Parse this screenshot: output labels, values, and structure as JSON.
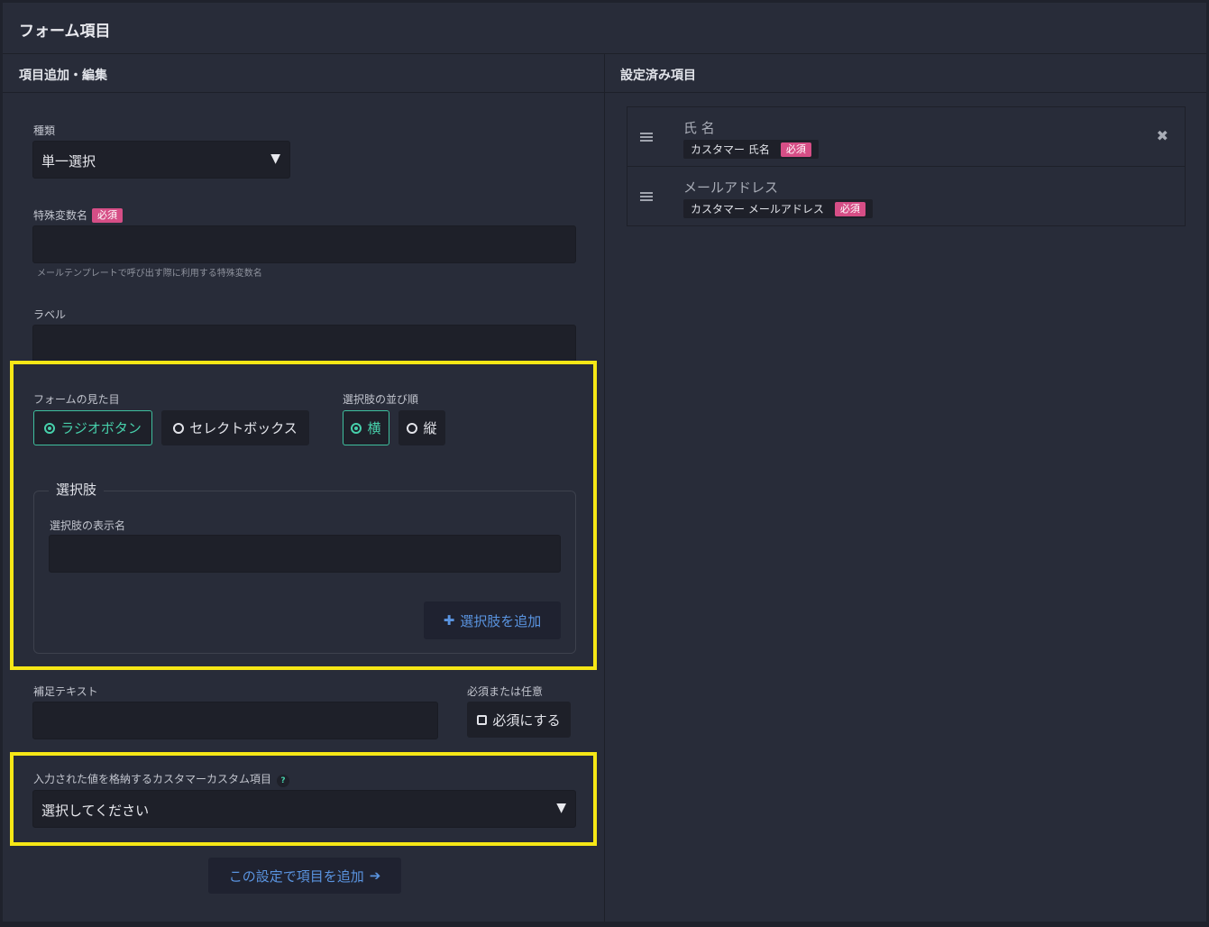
{
  "page": {
    "title": "フォーム項目"
  },
  "left": {
    "heading": "項目追加・編集",
    "type": {
      "label": "種類",
      "value": "単一選択"
    },
    "variable": {
      "label": "特殊変数名",
      "required": "必須",
      "hint": "メールテンプレートで呼び出す際に利用する特殊変数名",
      "value": ""
    },
    "label_field": {
      "label": "ラベル",
      "value": ""
    },
    "appearance": {
      "label": "フォームの見た目",
      "options": [
        "ラジオボタン",
        "セレクトボックス"
      ],
      "selected": 0
    },
    "order": {
      "label": "選択肢の並び順",
      "options": [
        "横",
        "縦"
      ],
      "selected": 0
    },
    "choices": {
      "legend": "選択肢",
      "display_label": "選択肢の表示名",
      "value": "",
      "add_button": "選択肢を追加"
    },
    "supplement": {
      "label": "補足テキスト",
      "value": ""
    },
    "required_opt": {
      "label": "必須または任意",
      "checkbox": "必須にする",
      "checked": false
    },
    "custom_field": {
      "label": "入力された値を格納するカスタマーカスタム項目",
      "help": "?",
      "value": "選択してください"
    },
    "submit": "この設定で項目を追加"
  },
  "right": {
    "heading": "設定済み項目",
    "items": [
      {
        "name": "氏 名",
        "tag": "カスタマー 氏名",
        "required": "必須",
        "removable": true
      },
      {
        "name": "メールアドレス",
        "tag": "カスタマー メールアドレス",
        "required": "必須",
        "removable": false
      }
    ]
  },
  "colors": {
    "accent": "#47d0ab",
    "link": "#5a94e0",
    "required": "#d64e86",
    "highlight": "#f6e716"
  }
}
